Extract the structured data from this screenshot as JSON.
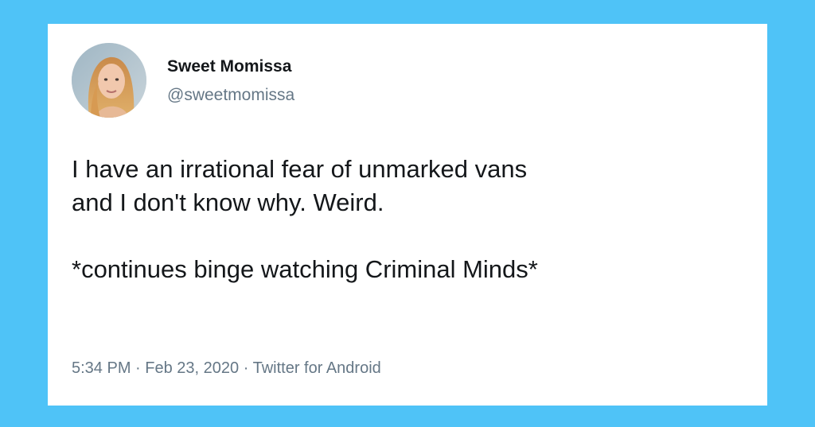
{
  "colors": {
    "background": "#4fc3f7",
    "card": "#ffffff",
    "text_primary": "#14171a",
    "text_secondary": "#657786"
  },
  "author": {
    "name": "Sweet Momissa",
    "handle": "@sweetmomissa",
    "avatar_icon": "profile-photo"
  },
  "tweet": {
    "line1": "I have an irrational fear of unmarked vans",
    "line2": "and I don't know why. Weird.",
    "line3": "*continues binge watching Criminal Minds*"
  },
  "meta": {
    "time": "5:34 PM",
    "separator": "·",
    "date": "Feb 23, 2020",
    "source": "Twitter for Android"
  }
}
